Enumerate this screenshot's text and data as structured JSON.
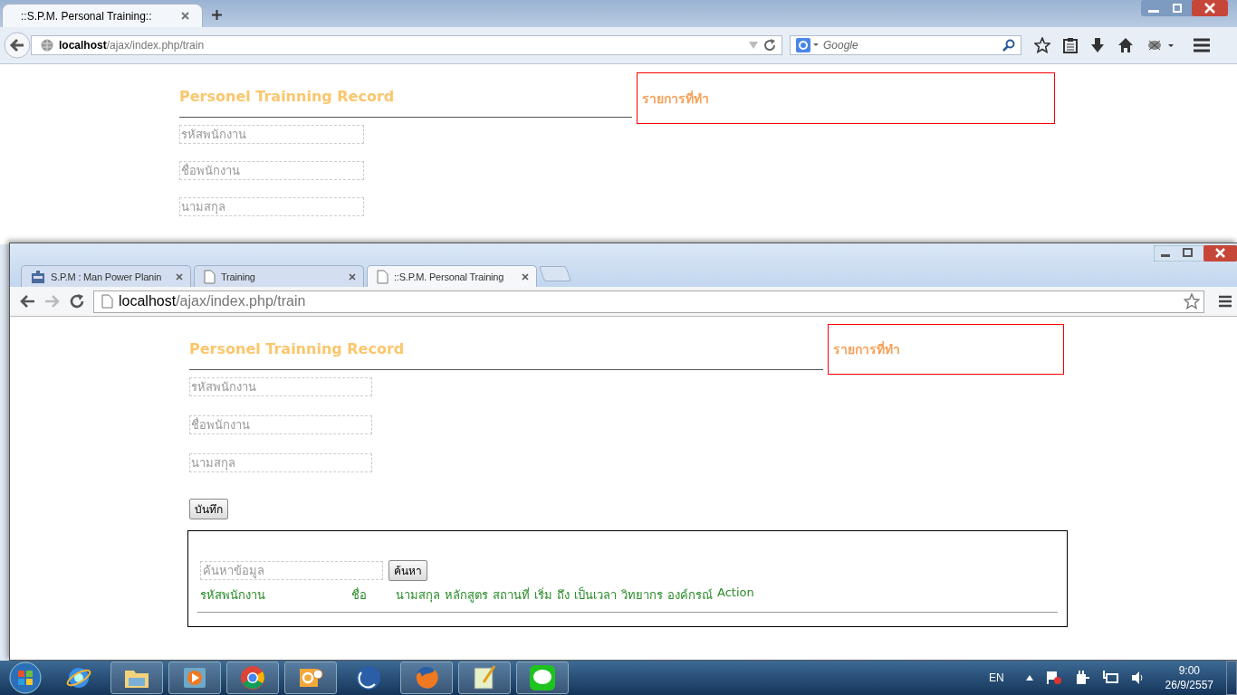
{
  "back_window": {
    "tab_title": "::S.P.M. Personal Training::",
    "url_host": "localhost",
    "url_path": "/ajax/index.php/train",
    "search_placeholder": "Google",
    "page": {
      "heading": "Personel Trainning Record",
      "panel_title": "รายการที่ทำ",
      "fields": [
        {
          "placeholder": "รหัสพนักงาน"
        },
        {
          "placeholder": "ชื่อพนักงาน"
        },
        {
          "placeholder": "นามสกุล"
        }
      ]
    }
  },
  "front_window": {
    "tabs": [
      {
        "label": "S.P.M : Man Power Planin",
        "selected": false,
        "kind": "app"
      },
      {
        "label": "Training",
        "selected": false,
        "kind": "page"
      },
      {
        "label": "::S.P.M. Personal Training",
        "selected": true,
        "kind": "page"
      }
    ],
    "url_host": "localhost",
    "url_path": "/ajax/index.php/train",
    "page": {
      "heading": "Personel Trainning Record",
      "panel_title": "รายการที่ทำ",
      "fields": [
        {
          "placeholder": "รหัสพนักงาน"
        },
        {
          "placeholder": "ชื่อพนักงาน"
        },
        {
          "placeholder": "นามสกุล"
        }
      ],
      "save_button": "บันทึก",
      "search_placeholder": "ค้นหาข้อมูล",
      "search_button": "ค้นหา",
      "columns": [
        "รหัสพนักงาน",
        "ชื่อ",
        "นามสกุล",
        "หลักสูตร",
        "สถานที่",
        "เริ่ม",
        "ถึง",
        "เป็นเวลา",
        "วิทยากร",
        "องค์กรณ์",
        "Action"
      ]
    }
  },
  "taskbar": {
    "apps": [
      {
        "kind": "ie"
      },
      {
        "kind": "folder"
      },
      {
        "kind": "media"
      },
      {
        "kind": "chrome"
      },
      {
        "kind": "outlook"
      },
      {
        "kind": "crescent"
      },
      {
        "kind": "firefox"
      },
      {
        "kind": "notepad"
      },
      {
        "kind": "line"
      }
    ],
    "language": "EN",
    "time": "9:00",
    "date": "26/9/2557"
  }
}
